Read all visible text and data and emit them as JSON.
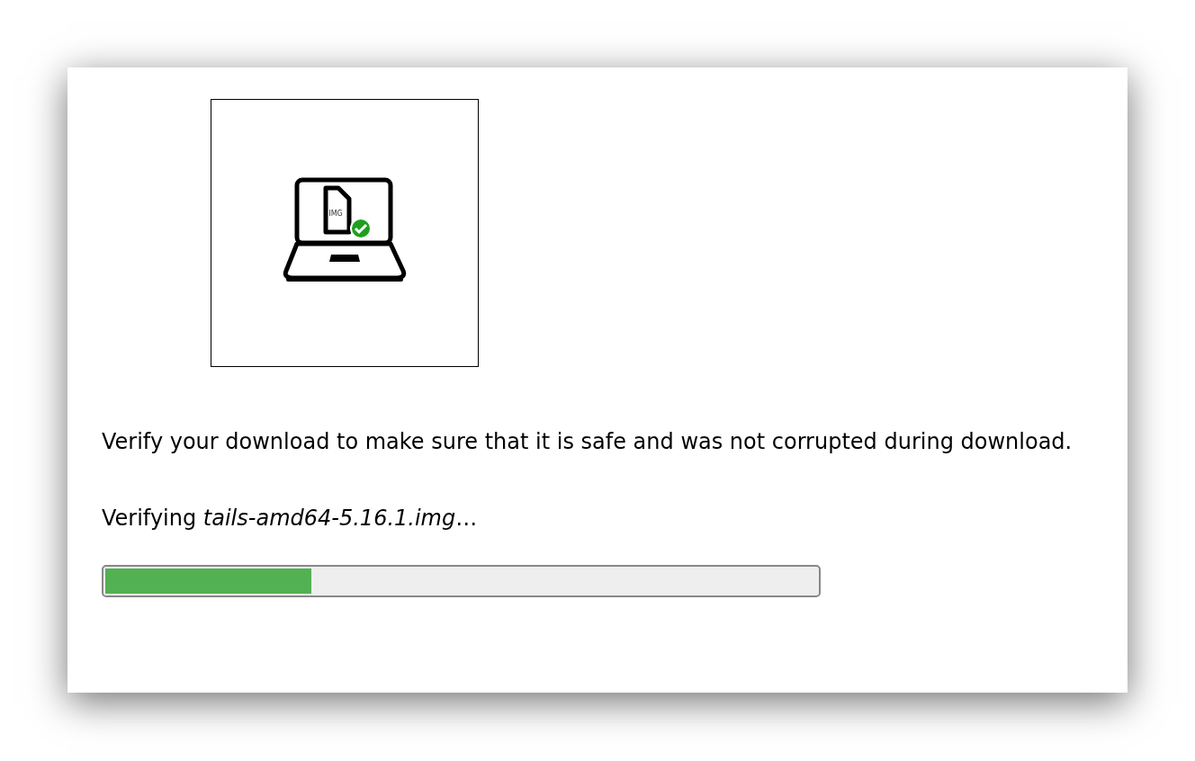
{
  "illustration": {
    "file_label": "IMG"
  },
  "description": "Verify your download to make sure that it is safe and was not corrupted during download.",
  "status": "Verifying *tails-amd64-5.16.1.img*…",
  "progress": {
    "level": 0.29
  }
}
